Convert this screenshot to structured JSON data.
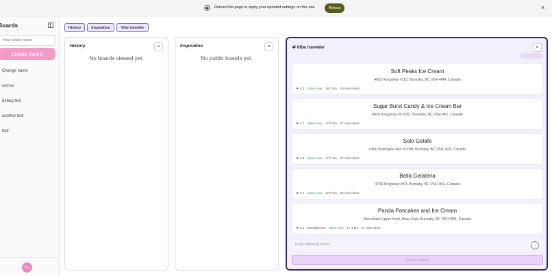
{
  "notification": {
    "message": "Reload this page to apply your updated settings on this site",
    "reload_label": "Reload",
    "close_label": "×",
    "icon": "gear-icon"
  },
  "sidebar": {
    "title": "Boards",
    "input_placeholder": "New board name",
    "create_label": "Create board",
    "items": [
      "Change name",
      "comox",
      "debug test",
      "another test",
      "test"
    ],
    "avatar_initials": "YU"
  },
  "tabs": [
    "History",
    "Inspiration",
    "Vibe traveller"
  ],
  "panels": {
    "history": {
      "title": "History",
      "empty": "No boards viewed yet."
    },
    "inspiration": {
      "title": "Inspiration",
      "empty": "No public boards yet."
    }
  },
  "vibe": {
    "title": "Vibe traveller",
    "close_label": "×",
    "results": [
      {
        "name": "Soft Peaks Ice Cream",
        "address": "4603 Kingsway #115, Burnaby, BC V5H 4M4, Canada",
        "rating": "★ 4.2",
        "price": "",
        "status": "Open now",
        "distance": "18.2 km",
        "drive": "29 mins drive"
      },
      {
        "name": "Sugar Burst Candy & Ice Cream Bar",
        "address": "4820 Kingsway #F105C, Burnaby, BC V5H 4P1, Canada",
        "rating": "★ 4.7",
        "price": "",
        "status": "Open now",
        "distance": "17.5 km",
        "drive": "27 mins drive"
      },
      {
        "name": "Solo Gelafe",
        "address": "6450 Burlington Ave #120B, Burnaby, BC V5H 2E8, Canada",
        "rating": "★ 4.6",
        "price": "",
        "status": "Open now",
        "distance": "17.7 km",
        "drive": "27 mins drive"
      },
      {
        "name": "Bella Gelateria",
        "address": "4700 Kingsway #K3, Burnaby, BC V5H 4N2, Canada",
        "rating": "★ 4.1",
        "price": "",
        "status": "Open now",
        "distance": "17.5 km",
        "drive": "29 mins drive"
      },
      {
        "name": "Panda Pancakes and Ice Cream",
        "address": "Metrotown Upper level, Near Zara, Burnaby, BC V5H 4M1, Canada",
        "rating": "★ 4.4",
        "price": "MODERATE",
        "status": "Open now",
        "distance": "17.4 km",
        "drive": "27 mins drive"
      }
    ],
    "input_placeholder": "Keep exploring ideas...",
    "create_label": "Create board"
  },
  "colors": {
    "accent_pink": "#f49ac6",
    "tab_border": "#7b6aa3",
    "vibe_border": "#2a2580",
    "open_green": "#2f9a4b",
    "reload_button": "#565a1e"
  }
}
